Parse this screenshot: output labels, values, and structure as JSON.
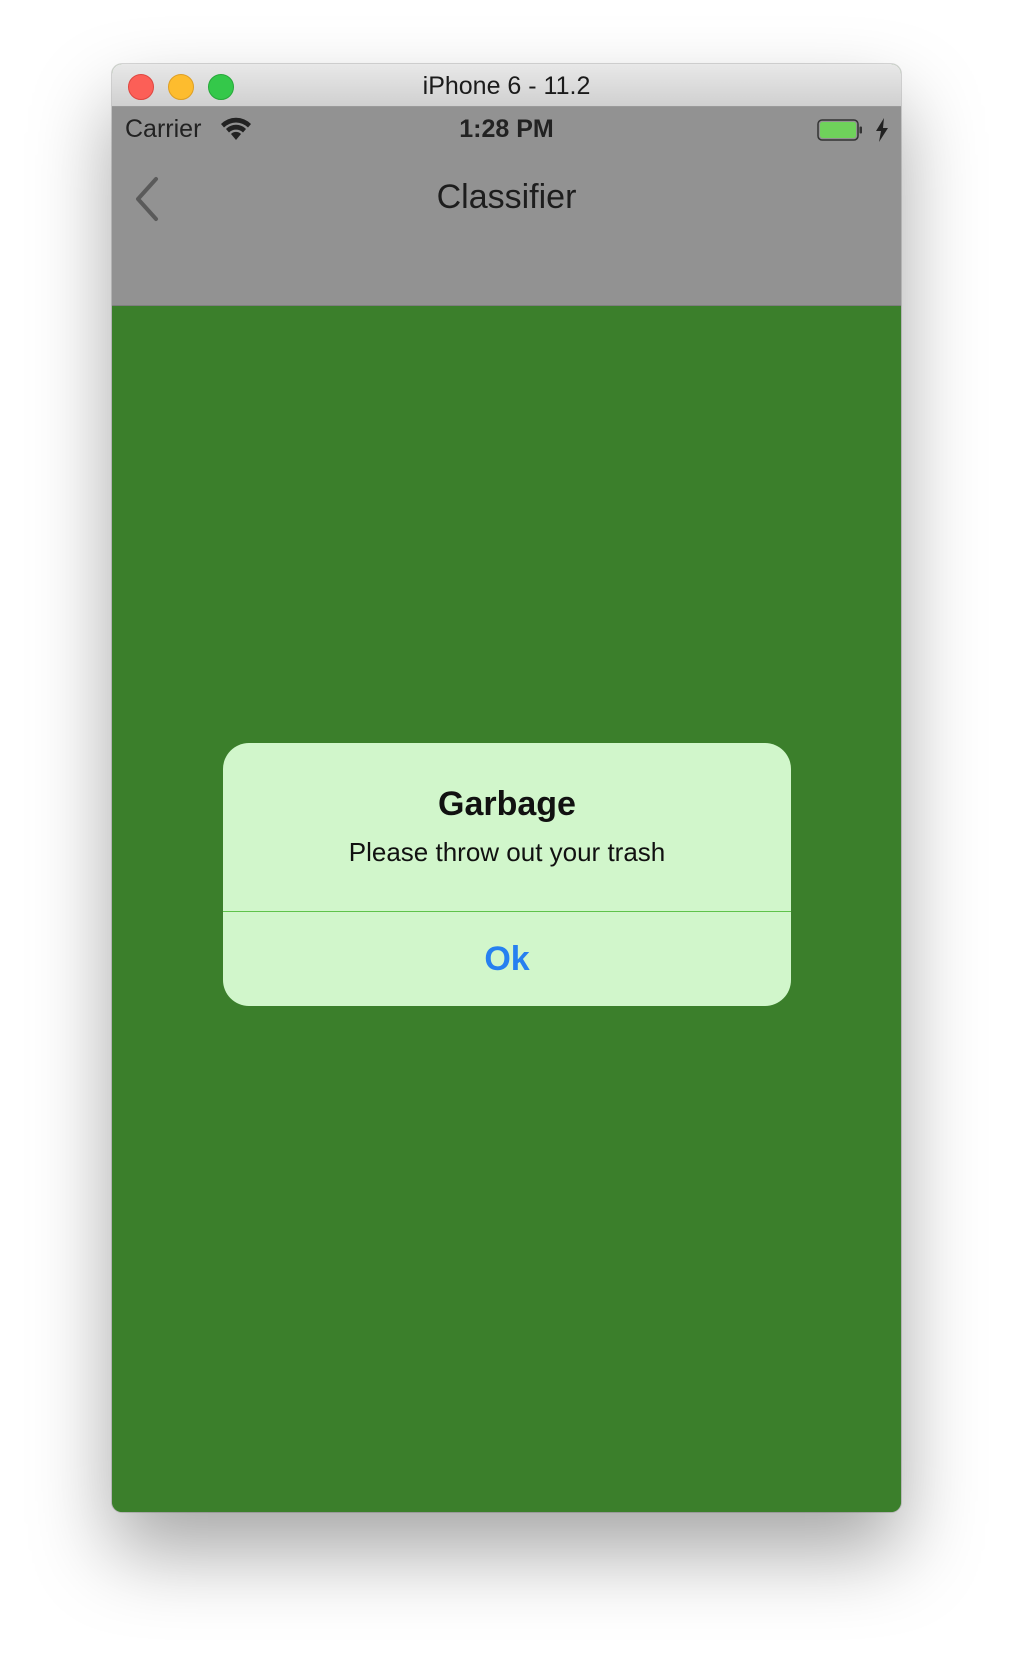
{
  "window": {
    "title": "iPhone 6 - 11.2"
  },
  "statusbar": {
    "carrier": "Carrier",
    "time": "1:28 PM",
    "battery_level": 1.0
  },
  "navbar": {
    "title": "Classifier",
    "back_icon": "chevron-left-icon"
  },
  "alert": {
    "title": "Garbage",
    "message": "Please throw out your trash",
    "button_label": "Ok"
  },
  "colors": {
    "background": "#3b7f2b",
    "alert_background": "#d1f6cb",
    "accent": "#2680f0",
    "bars": "#929292",
    "battery": "#6fd25b"
  }
}
